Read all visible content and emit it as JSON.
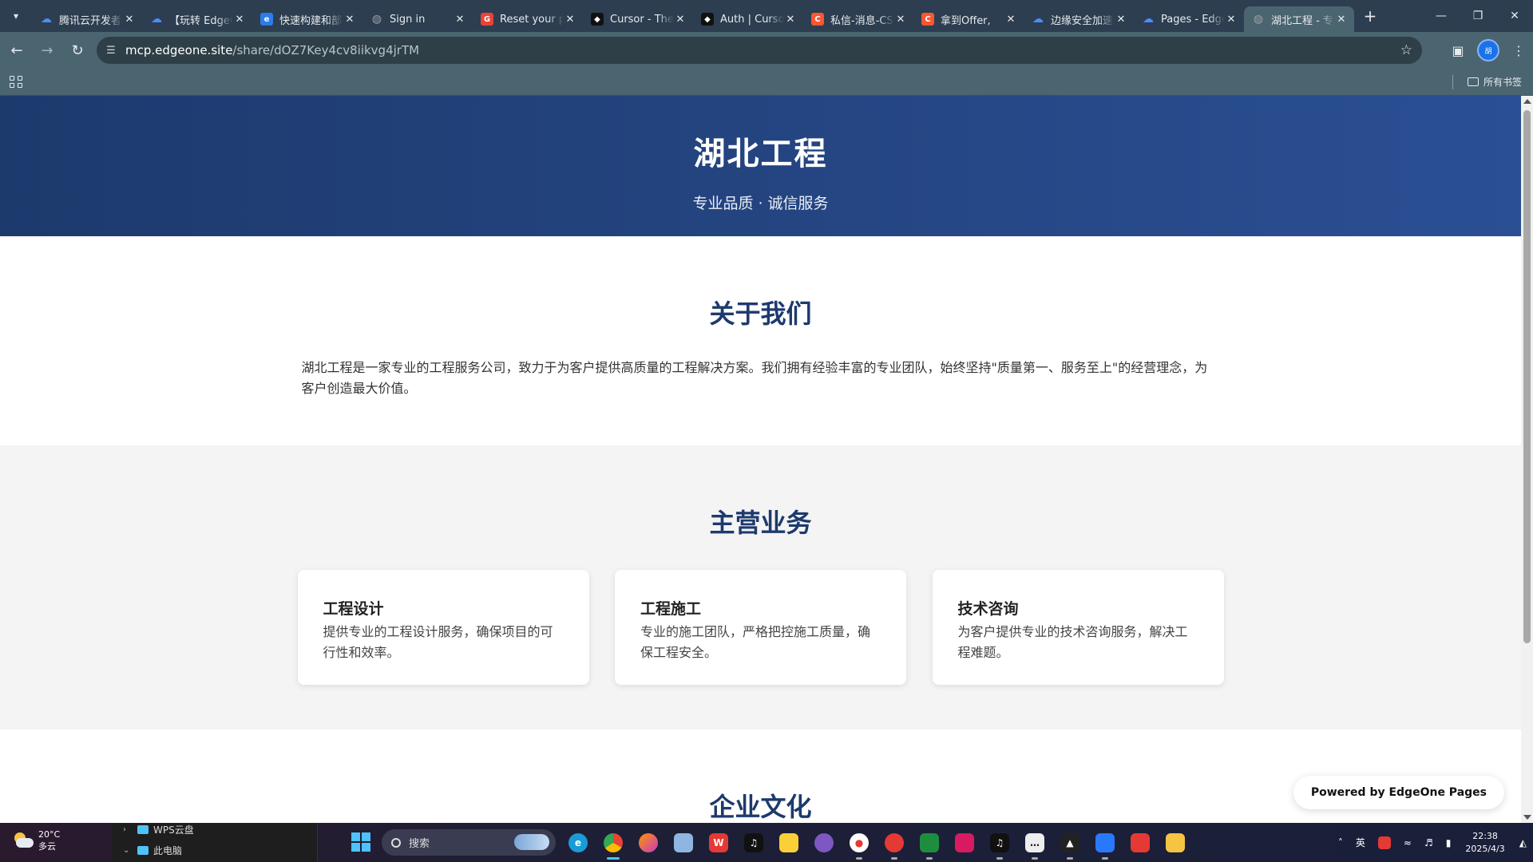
{
  "browser": {
    "tabs": [
      {
        "title": "腾讯云开发者社区",
        "icon": "cloud-icon",
        "color": "#4e8cff"
      },
      {
        "title": "【玩转 EdgeOne】",
        "icon": "cloud-icon",
        "color": "#4e8cff"
      },
      {
        "title": "快速构建和部署",
        "icon": "edge-icon",
        "color": "#2b7de9"
      },
      {
        "title": "Sign in",
        "icon": "globe-icon",
        "color": "#9aa0a6"
      },
      {
        "title": "Reset your password",
        "icon": "google-icon",
        "color": "#ea4335"
      },
      {
        "title": "Cursor - The AI Code Editor",
        "icon": "cursor-icon",
        "color": "#111111"
      },
      {
        "title": "Auth | Cursor",
        "icon": "cursor-icon",
        "color": "#111111"
      },
      {
        "title": "私信-消息-CSDN",
        "icon": "csdn-icon",
        "color": "#fc5531"
      },
      {
        "title": "拿到Offer,",
        "icon": "csdn-icon",
        "color": "#fc5531"
      },
      {
        "title": "边缘安全加速平台",
        "icon": "cloud-icon",
        "color": "#4e8cff"
      },
      {
        "title": "Pages - EdgeOne",
        "icon": "cloud-icon",
        "color": "#4e8cff"
      },
      {
        "title": "湖北工程 - 专业",
        "icon": "globe-icon",
        "color": "#9aa0a6",
        "active": true
      }
    ],
    "url_host": "mcp.edgeone.site",
    "url_path": "/share/dOZ7Key4cv8iikvg4jrTM",
    "profile_initial": "胡",
    "bookmarks_all": "所有书签"
  },
  "page": {
    "hero_title": "湖北工程",
    "hero_subtitle": "专业品质 · 诚信服务",
    "about_title": "关于我们",
    "about_text": "湖北工程是一家专业的工程服务公司，致力于为客户提供高质量的工程解决方案。我们拥有经验丰富的专业团队，始终坚持\"质量第一、服务至上\"的经营理念，为客户创造最大价值。",
    "services_title": "主营业务",
    "services": [
      {
        "title": "工程设计",
        "text": "提供专业的工程设计服务，确保项目的可行性和效率。"
      },
      {
        "title": "工程施工",
        "text": "专业的施工团队，严格把控施工质量，确保工程安全。"
      },
      {
        "title": "技术咨询",
        "text": "为客户提供专业的技术咨询服务，解决工程难题。"
      }
    ],
    "culture_title": "企业文化",
    "powered_by": "Powered by EdgeOne Pages"
  },
  "taskbar": {
    "weather_temp": "20°C",
    "weather_desc": "多云",
    "explorer_item_top": "WPS云盘",
    "explorer_item_bottom": "此电脑",
    "search_placeholder": "搜索",
    "ime": "英",
    "time": "22:38",
    "date": "2025/4/3"
  },
  "colors": {
    "hero_start": "#1d3a6d",
    "hero_end": "#2b4f94",
    "section_title": "#1d3a6d",
    "browser_frame": "#4a6570"
  }
}
